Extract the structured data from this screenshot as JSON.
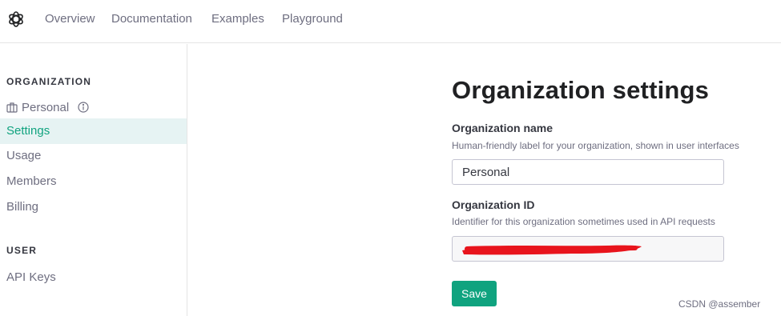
{
  "nav": {
    "links": [
      "Overview",
      "Documentation",
      "Examples",
      "Playground"
    ]
  },
  "sidebar": {
    "org_section": "ORGANIZATION",
    "org_name": "Personal",
    "items": [
      "Settings",
      "Usage",
      "Members",
      "Billing"
    ],
    "user_section": "USER",
    "user_items": [
      "API Keys"
    ],
    "active_item": "Settings"
  },
  "main": {
    "title": "Organization settings",
    "org_name": {
      "label": "Organization name",
      "help": "Human-friendly label for your organization, shown in user interfaces",
      "value": "Personal"
    },
    "org_id": {
      "label": "Organization ID",
      "help": "Identifier for this organization sometimes used in API requests",
      "value": ""
    },
    "save_label": "Save"
  },
  "watermark": "CSDN @assember",
  "colors": {
    "accent": "#10a37f",
    "active_bg": "#e6f3f3",
    "redaction": "#e8141c"
  },
  "icons": {
    "logo": "openai-logo-icon",
    "org": "briefcase-icon",
    "info": "info-icon"
  }
}
